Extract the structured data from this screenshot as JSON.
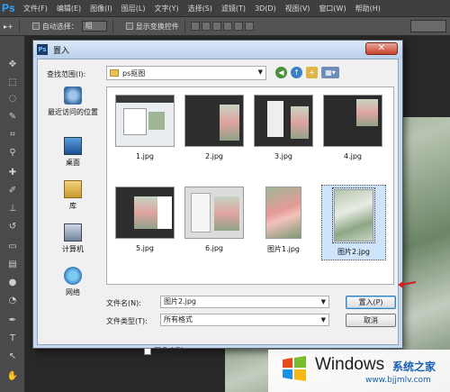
{
  "app": {
    "logo": "Ps",
    "menu": [
      "文件(F)",
      "编辑(E)",
      "图像(I)",
      "图层(L)",
      "文字(Y)",
      "选择(S)",
      "滤镜(T)",
      "3D(D)",
      "视图(V)",
      "窗口(W)",
      "帮助(H)"
    ]
  },
  "options": {
    "auto_select_label": "自动选择：",
    "auto_select_value": "组",
    "show_transform_label": "显示变换控件"
  },
  "dialog": {
    "title": "置入",
    "lookin_label": "查找范围(I):",
    "lookin_value": "ps抠图",
    "places": [
      {
        "label": "最近访问的位置",
        "icon": "recent-places-icon"
      },
      {
        "label": "桌面",
        "icon": "desktop-icon"
      },
      {
        "label": "库",
        "icon": "libraries-icon"
      },
      {
        "label": "计算机",
        "icon": "computer-icon"
      },
      {
        "label": "网络",
        "icon": "network-icon"
      }
    ],
    "files": [
      {
        "name": "1.jpg"
      },
      {
        "name": "2.jpg"
      },
      {
        "name": "3.jpg"
      },
      {
        "name": "4.jpg"
      },
      {
        "name": "5.jpg"
      },
      {
        "name": "6.jpg"
      },
      {
        "name": "图片1.jpg"
      },
      {
        "name": "图片2.jpg",
        "selected": true
      }
    ],
    "filename_label": "文件名(N):",
    "filename_value": "图片2.jpg",
    "filetype_label": "文件类型(T):",
    "filetype_value": "所有格式",
    "place_button": "置入(P)",
    "cancel_button": "取消",
    "image_sequence_label": "图像序列"
  },
  "watermark": {
    "brand": "Windows",
    "cn": "系统之家",
    "url": "www.bjjmlv.com"
  },
  "colors": {
    "accent": "#31a8ff",
    "close": "#c7412a",
    "selection": "#cde4fb"
  }
}
